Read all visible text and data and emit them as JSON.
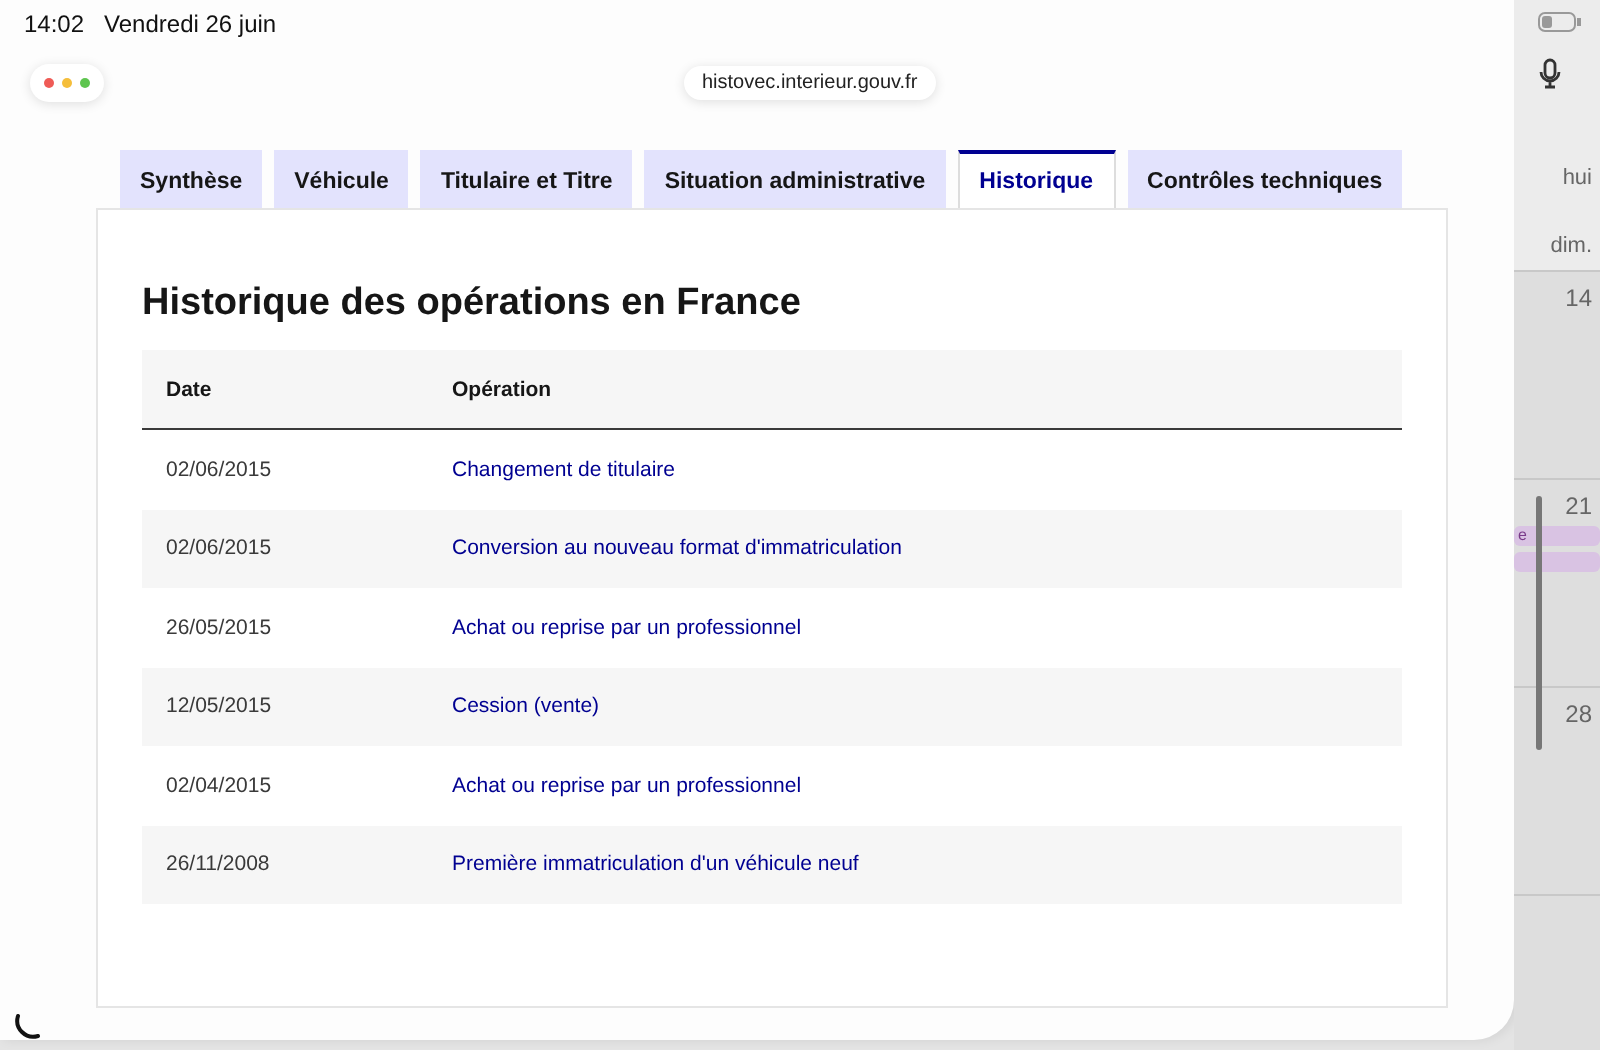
{
  "status_bar": {
    "time": "14:02",
    "date": "Vendredi 26 juin"
  },
  "browser": {
    "url": "histovec.interieur.gouv.fr"
  },
  "tabs": [
    {
      "label": "Synthèse",
      "selected": false
    },
    {
      "label": "Véhicule",
      "selected": false
    },
    {
      "label": "Titulaire et Titre",
      "selected": false
    },
    {
      "label": "Situation administrative",
      "selected": false
    },
    {
      "label": "Historique",
      "selected": true
    },
    {
      "label": "Contrôles techniques",
      "selected": false
    }
  ],
  "heading": "Historique des opérations en France",
  "table": {
    "columns": [
      "Date",
      "Opération"
    ],
    "rows": [
      {
        "date": "02/06/2015",
        "operation": "Changement de titulaire"
      },
      {
        "date": "02/06/2015",
        "operation": "Conversion au nouveau format d'immatriculation"
      },
      {
        "date": "26/05/2015",
        "operation": "Achat ou reprise par un professionnel"
      },
      {
        "date": "12/05/2015",
        "operation": "Cession (vente)"
      },
      {
        "date": "02/04/2015",
        "operation": "Achat ou reprise par un professionnel"
      },
      {
        "date": "26/11/2008",
        "operation": "Première immatriculation d'un véhicule neuf"
      }
    ]
  },
  "calendar": {
    "header": "hui",
    "weekday": "dim.",
    "days": [
      {
        "number": "14"
      },
      {
        "number": "21",
        "events": [
          {
            "title": "e",
            "color": "#d9c3e3"
          },
          {
            "color": "#d9c3e3"
          }
        ]
      },
      {
        "number": "28"
      }
    ]
  }
}
